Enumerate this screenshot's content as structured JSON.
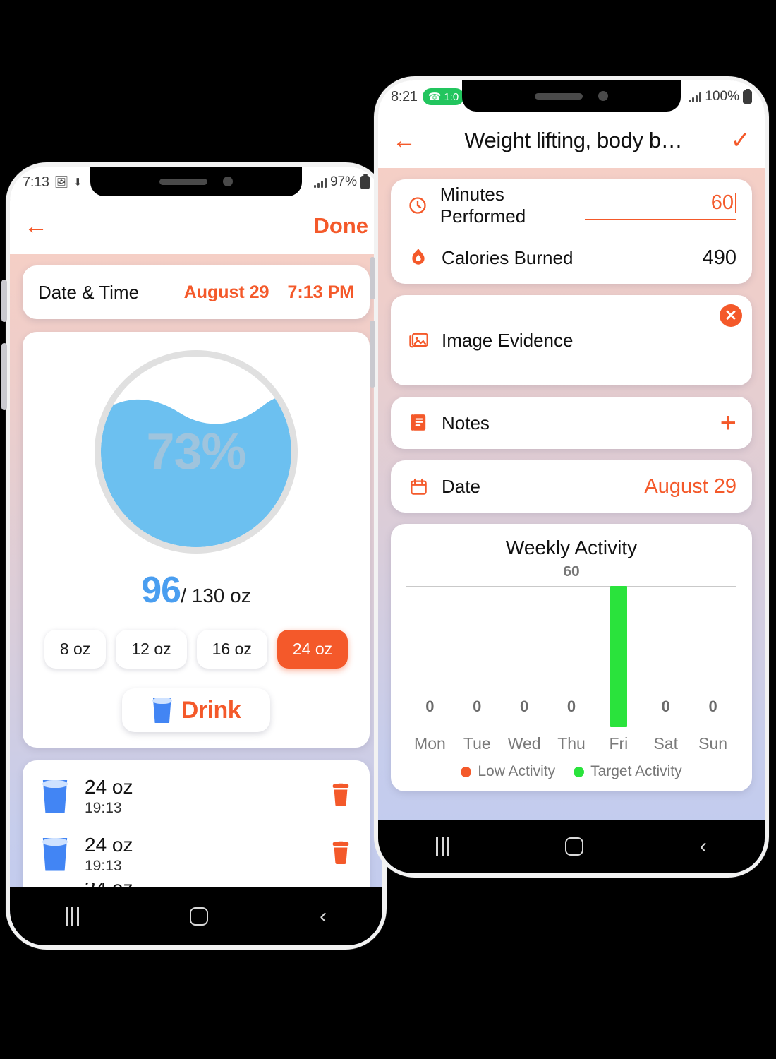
{
  "left_phone": {
    "status_bar": {
      "time": "7:13",
      "battery_pct": "97%",
      "icons": [
        "image-icon",
        "download-icon",
        "signal-icon",
        "battery-icon"
      ]
    },
    "app_bar": {
      "back_icon": "arrow-left-icon",
      "done_label": "Done"
    },
    "date_time_card": {
      "label": "Date & Time",
      "date": "August 29",
      "time": "7:13 PM"
    },
    "water_progress": {
      "percent_label": "73%",
      "percent_value": 73,
      "current": "96",
      "goal_suffix": "/ 130 oz",
      "goal_value": 130,
      "unit": "oz"
    },
    "amount_options": [
      {
        "label": "8 oz",
        "selected": false
      },
      {
        "label": "12 oz",
        "selected": false
      },
      {
        "label": "16 oz",
        "selected": false
      },
      {
        "label": "24 oz",
        "selected": true
      }
    ],
    "drink_button": {
      "label": "Drink",
      "icon": "water-glass-icon"
    },
    "log_entries": [
      {
        "amount": "24 oz",
        "time": "19:13",
        "icon": "water-glass-icon",
        "delete_icon": "trash-icon"
      },
      {
        "amount": "24 oz",
        "time": "19:13",
        "icon": "water-glass-icon",
        "delete_icon": "trash-icon"
      }
    ],
    "nav_bar": {
      "recent": "recents-icon",
      "home": "home-icon",
      "back": "back-icon"
    }
  },
  "right_phone": {
    "status_bar": {
      "time": "8:21",
      "call_pill": "1:0",
      "battery_pct": "100%",
      "icons": [
        "phone-call-icon",
        "signal-icon",
        "battery-icon"
      ]
    },
    "app_bar": {
      "back_icon": "arrow-left-icon",
      "title": "Weight lifting, body b…",
      "confirm_icon": "check-icon"
    },
    "metrics_card": {
      "minutes": {
        "icon": "clock-icon",
        "label": "Minutes Performed",
        "value": "60"
      },
      "calories": {
        "icon": "flame-icon",
        "label": "Calories Burned",
        "value": "490"
      }
    },
    "image_evidence": {
      "icon": "image-icon",
      "label": "Image Evidence",
      "remove_icon": "close-icon",
      "thumbnail_alt": "gym-photo"
    },
    "notes": {
      "icon": "notebook-icon",
      "label": "Notes",
      "add_icon": "plus-icon"
    },
    "date": {
      "icon": "calendar-icon",
      "label": "Date",
      "value": "August 29"
    },
    "nav_bar": {
      "recent": "recents-icon",
      "home": "home-icon",
      "back": "back-icon"
    }
  },
  "chart_data": {
    "type": "bar",
    "title": "Weekly Activity",
    "peak_label": "60",
    "categories": [
      "Mon",
      "Tue",
      "Wed",
      "Thu",
      "Fri",
      "Sat",
      "Sun"
    ],
    "values": [
      0,
      0,
      0,
      0,
      60,
      0,
      0
    ],
    "value_labels": [
      "0",
      "0",
      "0",
      "0",
      "",
      "0",
      "0"
    ],
    "ylim": [
      0,
      60
    ],
    "xlabel": "",
    "ylabel": "",
    "grid": true,
    "legend_position": "bottom",
    "legend": [
      {
        "label": "Low Activity",
        "color": "#f4592a"
      },
      {
        "label": "Target Activity",
        "color": "#2ae33c"
      }
    ],
    "bar_color": "#2ae33c"
  },
  "colors": {
    "accent": "#f4592a",
    "water": "#6cc0f0",
    "water_number": "#4a9ef0",
    "target_green": "#2ae33c"
  }
}
